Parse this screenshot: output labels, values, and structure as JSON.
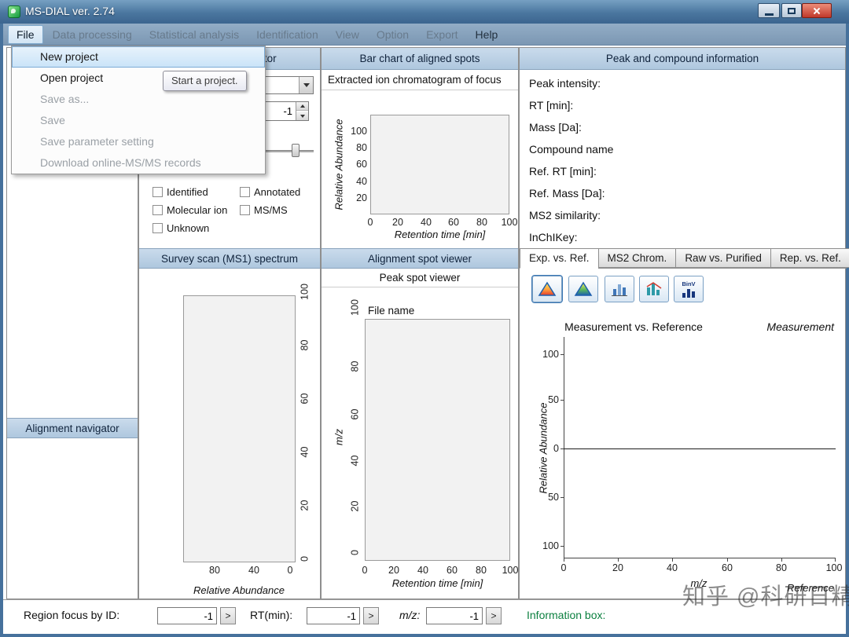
{
  "window": {
    "title": "MS-DIAL ver. 2.74"
  },
  "menubar": {
    "items": [
      {
        "label": "File",
        "enabled": true
      },
      {
        "label": "Data processing",
        "enabled": false
      },
      {
        "label": "Statistical analysis",
        "enabled": false
      },
      {
        "label": "Identification",
        "enabled": false
      },
      {
        "label": "View",
        "enabled": false
      },
      {
        "label": "Option",
        "enabled": false
      },
      {
        "label": "Export",
        "enabled": false
      },
      {
        "label": "Help",
        "enabled": true
      }
    ]
  },
  "file_menu": {
    "items": [
      {
        "label": "New project",
        "enabled": true,
        "highlighted": true
      },
      {
        "label": "Open project",
        "enabled": true,
        "highlighted": false
      },
      {
        "label": "Save as...",
        "enabled": false,
        "highlighted": false
      },
      {
        "label": "Save",
        "enabled": false,
        "highlighted": false
      },
      {
        "label": "Save parameter setting",
        "enabled": false,
        "highlighted": false
      },
      {
        "label": "Download online-MS/MS records",
        "enabled": false,
        "highlighted": false
      }
    ],
    "tooltip": "Start a project."
  },
  "left_nav": {
    "alignment_navigator_header": "Alignment navigator"
  },
  "peak_spot_navigator": {
    "header": "Peak spot navigator",
    "spinner_value": "-1",
    "filters": [
      "Identified",
      "Annotated",
      "Molecular ion",
      "MS/MS",
      "Unknown"
    ]
  },
  "survey_scan": {
    "header": "Survey scan (MS1) spectrum",
    "xlabel": "Relative Abundance",
    "xticks": [
      "80",
      "40",
      "0"
    ],
    "side_ticks": [
      "100",
      "80",
      "60",
      "40",
      "20",
      "0"
    ]
  },
  "eic_panel": {
    "header": "Bar chart of aligned spots",
    "subheader": "Extracted ion chromatogram of focus",
    "ylabel": "Relative Abundance",
    "yticks": [
      "100",
      "80",
      "60",
      "40",
      "20"
    ],
    "xticks": [
      "0",
      "20",
      "40",
      "60",
      "80",
      "100"
    ],
    "xlabel": "Retention time [min]"
  },
  "spot_viewer": {
    "alignment_header": "Alignment spot viewer",
    "peak_header": "Peak spot viewer",
    "file_name_label": "File name",
    "ylabel": "m/z",
    "side_ticks": [
      "100",
      "80",
      "60",
      "40",
      "20",
      "0"
    ],
    "xticks": [
      "0",
      "20",
      "40",
      "60",
      "80",
      "100"
    ],
    "xlabel": "Retention time [min]"
  },
  "peak_info": {
    "header": "Peak and compound information",
    "fields": [
      "Peak intensity:",
      "RT [min]:",
      "Mass [Da]:",
      "Compound name",
      "Ref. RT [min]:",
      "Ref. Mass [Da]:",
      "MS2 similarity:",
      "InChIKey:"
    ]
  },
  "tabs": [
    {
      "label": "Exp. vs. Ref.",
      "selected": true
    },
    {
      "label": "MS2 Chrom.",
      "selected": false
    },
    {
      "label": "Raw vs. Purified",
      "selected": false
    },
    {
      "label": "Rep. vs. Ref.",
      "selected": false
    }
  ],
  "toolbar": {
    "binv_label": "BinV"
  },
  "ms2_chart": {
    "title": "Measurement vs. Reference",
    "top_right_label": "Measurement",
    "ylabel": "Relative Abundance",
    "yticks": [
      "100",
      "50",
      "0",
      "50",
      "100"
    ],
    "xticks": [
      "0",
      "20",
      "40",
      "60",
      "80",
      "100"
    ],
    "xlabel": "m/z",
    "bottom_right_label": "Reference"
  },
  "bottom_bar": {
    "region_label": "Region focus by ID:",
    "region_value": "-1",
    "rt_label": "RT(min):",
    "rt_value": "-1",
    "mz_label": "m/z:",
    "mz_value": "-1",
    "go_label": ">",
    "info_label": "Information box:"
  },
  "watermark": "知乎 @科研日精进",
  "colors": {
    "titlebar": "#4a769f",
    "panel_header": "#b9cde2",
    "info_green": "#0c8040"
  }
}
